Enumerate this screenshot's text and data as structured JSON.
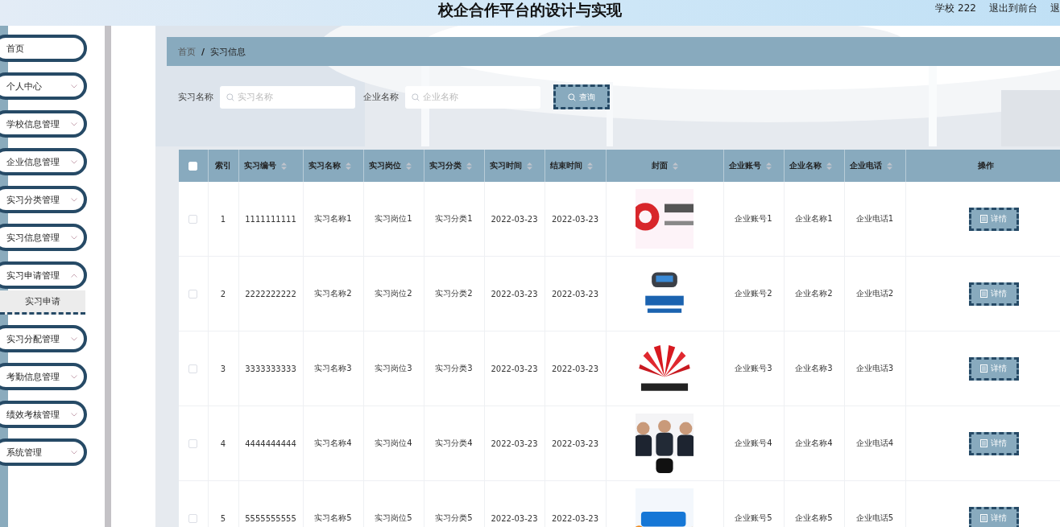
{
  "header": {
    "title": "校企合作平台的设计与实现",
    "links": [
      "学校 222",
      "退出到前台",
      "退"
    ]
  },
  "sidebar": {
    "items": [
      {
        "label": "首页",
        "kind": "link"
      },
      {
        "label": "个人中心",
        "kind": "menu",
        "expanded": false
      },
      {
        "label": "学校信息管理",
        "kind": "menu",
        "expanded": false
      },
      {
        "label": "企业信息管理",
        "kind": "menu",
        "expanded": false
      },
      {
        "label": "实习分类管理",
        "kind": "menu",
        "expanded": false
      },
      {
        "label": "实习信息管理",
        "kind": "menu",
        "expanded": false
      },
      {
        "label": "实习申请管理",
        "kind": "menu",
        "expanded": true,
        "children": [
          {
            "label": "实习申请"
          }
        ]
      },
      {
        "label": "实习分配管理",
        "kind": "menu",
        "expanded": false
      },
      {
        "label": "考勤信息管理",
        "kind": "menu",
        "expanded": false
      },
      {
        "label": "绩效考核管理",
        "kind": "menu",
        "expanded": false
      },
      {
        "label": "系统管理",
        "kind": "menu",
        "expanded": false
      }
    ]
  },
  "breadcrumb": {
    "separator": "/",
    "items": [
      {
        "label": "首页",
        "current": false
      },
      {
        "label": "实习信息",
        "current": true
      }
    ]
  },
  "search": {
    "fields": [
      {
        "label": "实习名称",
        "placeholder": "实习名称"
      },
      {
        "label": "企业名称",
        "placeholder": "企业名称"
      }
    ],
    "button": "查询"
  },
  "table": {
    "select_all": {
      "checked": false
    },
    "columns": [
      {
        "label": "索引",
        "sortable": false
      },
      {
        "label": "实习编号",
        "sortable": true
      },
      {
        "label": "实习名称",
        "sortable": true
      },
      {
        "label": "实习岗位",
        "sortable": true
      },
      {
        "label": "实习分类",
        "sortable": true
      },
      {
        "label": "实习时间",
        "sortable": true
      },
      {
        "label": "结束时间",
        "sortable": true
      },
      {
        "label": "封面",
        "sortable": true
      },
      {
        "label": "企业账号",
        "sortable": true
      },
      {
        "label": "企业名称",
        "sortable": true
      },
      {
        "label": "企业电话",
        "sortable": true
      },
      {
        "label": "操作",
        "sortable": false
      }
    ],
    "rows": [
      {
        "checked": false,
        "index": "1",
        "number": "1111111111",
        "name": "实习名称1",
        "post": "实习岗位1",
        "category": "实习分类1",
        "start": "2022-03-23",
        "end": "2022-03-23",
        "account": "企业账号1",
        "company": "企业名称1",
        "phone": "企业电话1",
        "action": "详情"
      },
      {
        "checked": false,
        "index": "2",
        "number": "2222222222",
        "name": "实习名称2",
        "post": "实习岗位2",
        "category": "实习分类2",
        "start": "2022-03-23",
        "end": "2022-03-23",
        "account": "企业账号2",
        "company": "企业名称2",
        "phone": "企业电话2",
        "action": "详情"
      },
      {
        "checked": false,
        "index": "3",
        "number": "3333333333",
        "name": "实习名称3",
        "post": "实习岗位3",
        "category": "实习分类3",
        "start": "2022-03-23",
        "end": "2022-03-23",
        "account": "企业账号3",
        "company": "企业名称3",
        "phone": "企业电话3",
        "action": "详情"
      },
      {
        "checked": false,
        "index": "4",
        "number": "4444444444",
        "name": "实习名称4",
        "post": "实习岗位4",
        "category": "实习分类4",
        "start": "2022-03-23",
        "end": "2022-03-23",
        "account": "企业账号4",
        "company": "企业名称4",
        "phone": "企业电话4",
        "action": "详情"
      },
      {
        "checked": false,
        "index": "5",
        "number": "5555555555",
        "name": "实习名称5",
        "post": "实习岗位5",
        "category": "实习分类5",
        "start": "2022-03-23",
        "end": "2022-03-23",
        "account": "企业账号5",
        "company": "企业名称5",
        "phone": "企业电话5",
        "action": "详情"
      }
    ]
  }
}
